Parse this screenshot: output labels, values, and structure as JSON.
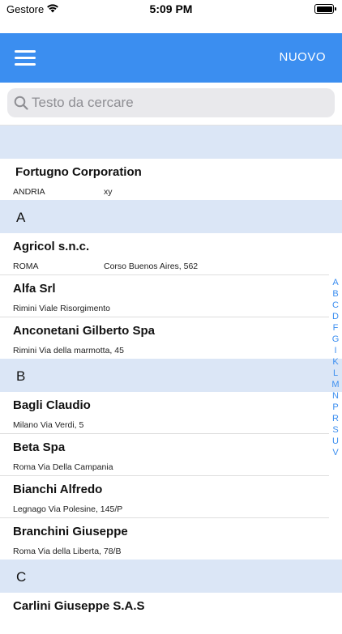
{
  "status": {
    "carrier": "Gestore",
    "time": "5:09 PM"
  },
  "nav": {
    "new_label": "NUOVO"
  },
  "search": {
    "placeholder": "Testo da cercare"
  },
  "top_row": {
    "name": "Fortugno Corporation",
    "city": "ANDRIA",
    "address": "xy"
  },
  "sections": [
    {
      "letter": "A",
      "rows": [
        {
          "name": "Agricol s.n.c.",
          "city": "ROMA",
          "address": "Corso Buenos Aires, 562"
        },
        {
          "name": "Alfa Srl",
          "city": "Rimini Viale Risorgimento",
          "address": ""
        },
        {
          "name": "Anconetani Gilberto Spa",
          "city": "Rimini Via della marmotta, 45",
          "address": ""
        }
      ]
    },
    {
      "letter": "B",
      "rows": [
        {
          "name": "Bagli Claudio",
          "city": "Milano Via Verdi, 5",
          "address": ""
        },
        {
          "name": "Beta Spa",
          "city": "Roma Via Della Campania",
          "address": ""
        },
        {
          "name": "Bianchi Alfredo",
          "city": "Legnago Via Polesine, 145/P",
          "address": ""
        },
        {
          "name": "Branchini Giuseppe",
          "city": "Roma Via della Liberta, 78/B",
          "address": ""
        }
      ]
    },
    {
      "letter": "C",
      "rows": [
        {
          "name": "Carlini Giuseppe S.A.S",
          "city": "",
          "address": ""
        }
      ]
    }
  ],
  "index_letters": [
    "A",
    "B",
    "C",
    "D",
    "F",
    "G",
    "I",
    "K",
    "L",
    "M",
    "N",
    "P",
    "R",
    "S",
    "U",
    "V"
  ],
  "colors": {
    "accent": "#3b8ef0",
    "section_bg": "#dbe6f6"
  }
}
